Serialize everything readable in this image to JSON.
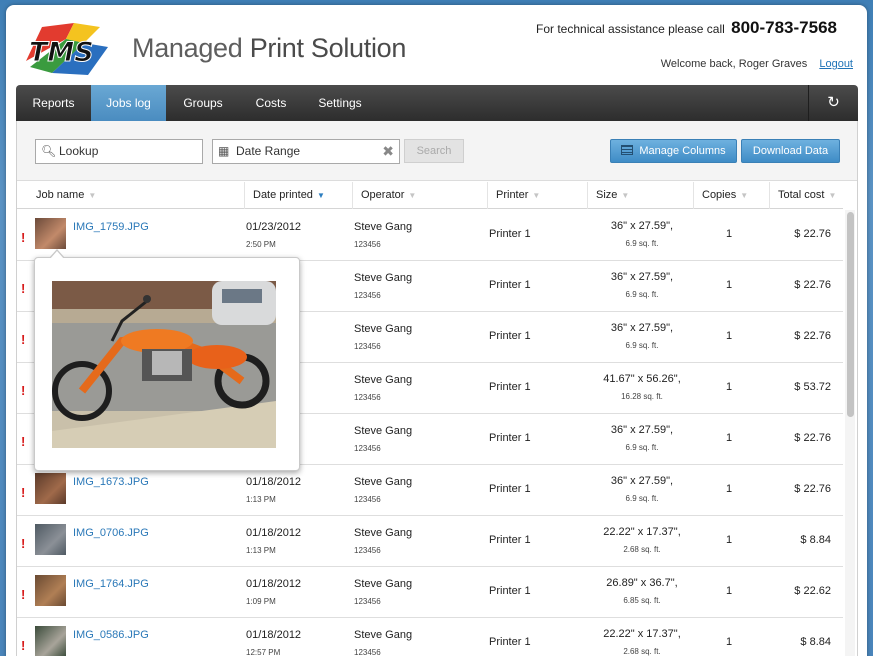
{
  "brand": {
    "logo_text": "TMS",
    "title_part1": "Managed ",
    "title_part2": "Print Solution"
  },
  "header": {
    "support_text": "For technical assistance please call",
    "support_phone": "800-783-7568",
    "welcome_text": "Welcome back, Roger Graves",
    "logout_label": "Logout"
  },
  "nav": {
    "tabs": [
      {
        "label": "Reports"
      },
      {
        "label": "Jobs log",
        "active": true
      },
      {
        "label": "Groups"
      },
      {
        "label": "Costs"
      },
      {
        "label": "Settings"
      }
    ],
    "refresh_icon": "refresh-icon"
  },
  "toolbar": {
    "lookup_placeholder": "Lookup",
    "date_range_placeholder": "Date Range",
    "search_label": "Search",
    "manage_columns_label": "Manage Columns",
    "download_label": "Download Data"
  },
  "table": {
    "columns": [
      "Job name",
      "Date printed",
      "Operator",
      "Printer",
      "Size",
      "Copies",
      "Total cost"
    ],
    "sorted_column": "Date printed",
    "rows": [
      {
        "name": "IMG_1759.JPG",
        "date": "01/23/2012",
        "time": "2:50 PM",
        "operator": "Steve Gang",
        "operator_id": "123456",
        "printer": "Printer 1",
        "size": "36\" x 27.59\",",
        "sqft": "6.9 sq. ft.",
        "copies": "1",
        "cost": "$ 22.76"
      },
      {
        "name": "",
        "date": "",
        "time": "",
        "operator": "Steve Gang",
        "operator_id": "123456",
        "printer": "Printer 1",
        "size": "36\" x 27.59\",",
        "sqft": "6.9 sq. ft.",
        "copies": "1",
        "cost": "$ 22.76"
      },
      {
        "name": "",
        "date": "",
        "time": "",
        "operator": "Steve Gang",
        "operator_id": "123456",
        "printer": "Printer 1",
        "size": "36\" x 27.59\",",
        "sqft": "6.9 sq. ft.",
        "copies": "1",
        "cost": "$ 22.76"
      },
      {
        "name": "",
        "date": "",
        "time": "",
        "operator": "Steve Gang",
        "operator_id": "123456",
        "printer": "Printer 1",
        "size": "41.67\" x 56.26\",",
        "sqft": "16.28 sq. ft.",
        "copies": "1",
        "cost": "$ 53.72"
      },
      {
        "name": "",
        "date": "",
        "time": "",
        "operator": "Steve Gang",
        "operator_id": "123456",
        "printer": "Printer 1",
        "size": "36\" x 27.59\",",
        "sqft": "6.9 sq. ft.",
        "copies": "1",
        "cost": "$ 22.76"
      },
      {
        "name": "IMG_1673.JPG",
        "date": "01/18/2012",
        "time": "1:13 PM",
        "operator": "Steve Gang",
        "operator_id": "123456",
        "printer": "Printer 1",
        "size": "36\" x 27.59\",",
        "sqft": "6.9 sq. ft.",
        "copies": "1",
        "cost": "$ 22.76"
      },
      {
        "name": "IMG_0706.JPG",
        "date": "01/18/2012",
        "time": "1:13 PM",
        "operator": "Steve Gang",
        "operator_id": "123456",
        "printer": "Printer 1",
        "size": "22.22\" x 17.37\",",
        "sqft": "2.68 sq. ft.",
        "copies": "1",
        "cost": "$ 8.84"
      },
      {
        "name": "IMG_1764.JPG",
        "date": "01/18/2012",
        "time": "1:09 PM",
        "operator": "Steve Gang",
        "operator_id": "123456",
        "printer": "Printer 1",
        "size": "26.89\" x 36.7\",",
        "sqft": "6.85 sq. ft.",
        "copies": "1",
        "cost": "$ 22.62"
      },
      {
        "name": "IMG_0586.JPG",
        "date": "01/18/2012",
        "time": "12:57 PM",
        "operator": "Steve Gang",
        "operator_id": "123456",
        "printer": "Printer 1",
        "size": "22.22\" x 17.37\",",
        "sqft": "2.68 sq. ft.",
        "copies": "1",
        "cost": "$ 8.84"
      }
    ]
  },
  "colors": {
    "accent": "#4a8cc0",
    "link": "#2a78b8",
    "warning": "#d71b1b"
  }
}
